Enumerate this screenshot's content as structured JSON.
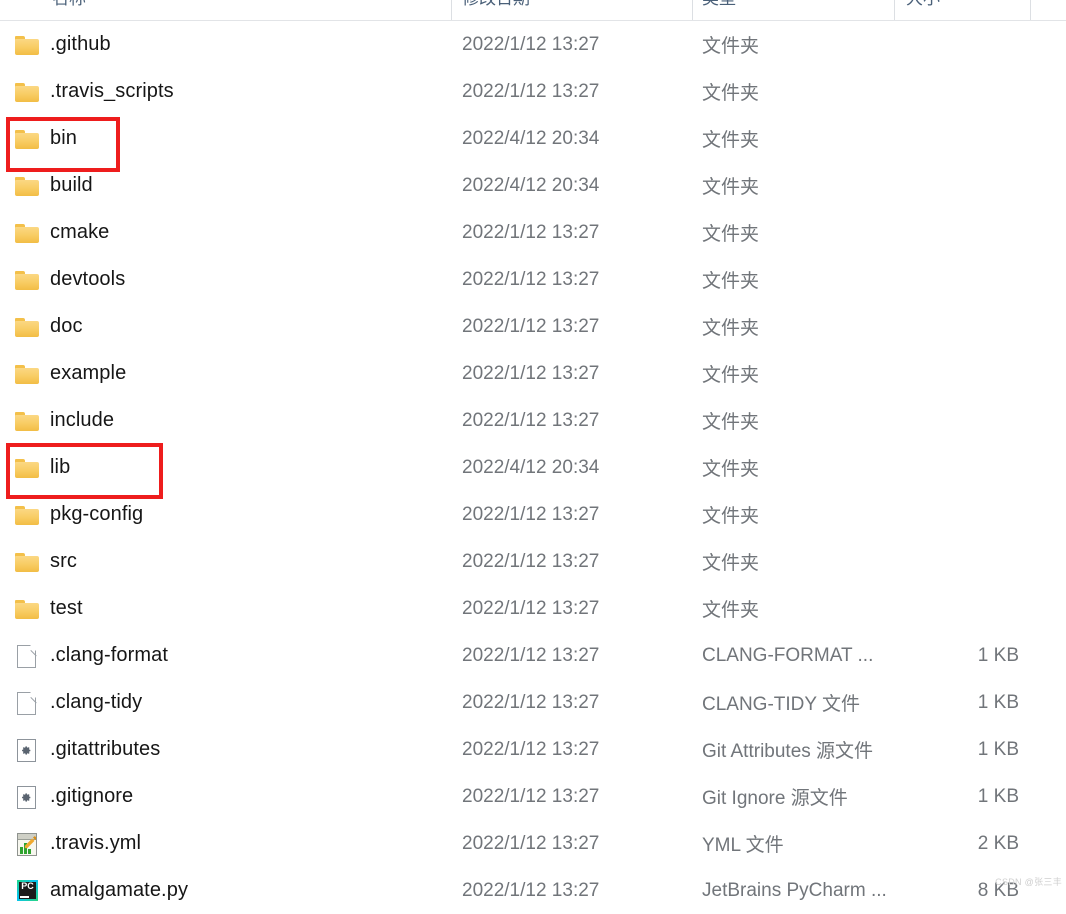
{
  "window": {
    "view": "details-list"
  },
  "columns": {
    "headers": [
      {
        "key": "name",
        "label": "名称"
      },
      {
        "key": "date",
        "label": "修改日期"
      },
      {
        "key": "type",
        "label": "类型"
      },
      {
        "key": "size",
        "label": "大小"
      }
    ]
  },
  "rows": [
    {
      "icon": "folder-icon",
      "name": ".github",
      "date": "2022/1/12 13:27",
      "type": "文件夹",
      "size": ""
    },
    {
      "icon": "folder-icon",
      "name": ".travis_scripts",
      "date": "2022/1/12 13:27",
      "type": "文件夹",
      "size": ""
    },
    {
      "icon": "folder-icon",
      "name": "bin",
      "date": "2022/4/12 20:34",
      "type": "文件夹",
      "size": ""
    },
    {
      "icon": "folder-icon",
      "name": "build",
      "date": "2022/4/12 20:34",
      "type": "文件夹",
      "size": ""
    },
    {
      "icon": "folder-icon",
      "name": "cmake",
      "date": "2022/1/12 13:27",
      "type": "文件夹",
      "size": ""
    },
    {
      "icon": "folder-icon",
      "name": "devtools",
      "date": "2022/1/12 13:27",
      "type": "文件夹",
      "size": ""
    },
    {
      "icon": "folder-icon",
      "name": "doc",
      "date": "2022/1/12 13:27",
      "type": "文件夹",
      "size": ""
    },
    {
      "icon": "folder-icon",
      "name": "example",
      "date": "2022/1/12 13:27",
      "type": "文件夹",
      "size": ""
    },
    {
      "icon": "folder-icon",
      "name": "include",
      "date": "2022/1/12 13:27",
      "type": "文件夹",
      "size": ""
    },
    {
      "icon": "folder-icon",
      "name": "lib",
      "date": "2022/4/12 20:34",
      "type": "文件夹",
      "size": ""
    },
    {
      "icon": "folder-icon",
      "name": "pkg-config",
      "date": "2022/1/12 13:27",
      "type": "文件夹",
      "size": ""
    },
    {
      "icon": "folder-icon",
      "name": "src",
      "date": "2022/1/12 13:27",
      "type": "文件夹",
      "size": ""
    },
    {
      "icon": "folder-icon",
      "name": "test",
      "date": "2022/1/12 13:27",
      "type": "文件夹",
      "size": ""
    },
    {
      "icon": "document-icon",
      "name": ".clang-format",
      "date": "2022/1/12 13:27",
      "type": "CLANG-FORMAT ...",
      "size": "1 KB"
    },
    {
      "icon": "document-icon",
      "name": ".clang-tidy",
      "date": "2022/1/12 13:27",
      "type": "CLANG-TIDY 文件",
      "size": "1 KB"
    },
    {
      "icon": "gear-document-icon",
      "name": ".gitattributes",
      "date": "2022/1/12 13:27",
      "type": "Git Attributes 源文件",
      "size": "1 KB"
    },
    {
      "icon": "gear-document-icon",
      "name": ".gitignore",
      "date": "2022/1/12 13:27",
      "type": "Git Ignore 源文件",
      "size": "1 KB"
    },
    {
      "icon": "yml-file-icon",
      "name": ".travis.yml",
      "date": "2022/1/12 13:27",
      "type": "YML 文件",
      "size": "2 KB"
    },
    {
      "icon": "pycharm-file-icon",
      "name": "amalgamate.py",
      "date": "2022/1/12 13:27",
      "type": "JetBrains PyCharm ...",
      "size": "8 KB"
    }
  ],
  "annotations": [
    {
      "name": "highlight-bin",
      "target": "bin",
      "color": "#ee1d1d"
    },
    {
      "name": "highlight-lib",
      "target": "lib",
      "color": "#ee1d1d"
    }
  ],
  "watermark": {
    "text": "CSDN @张三丰"
  }
}
